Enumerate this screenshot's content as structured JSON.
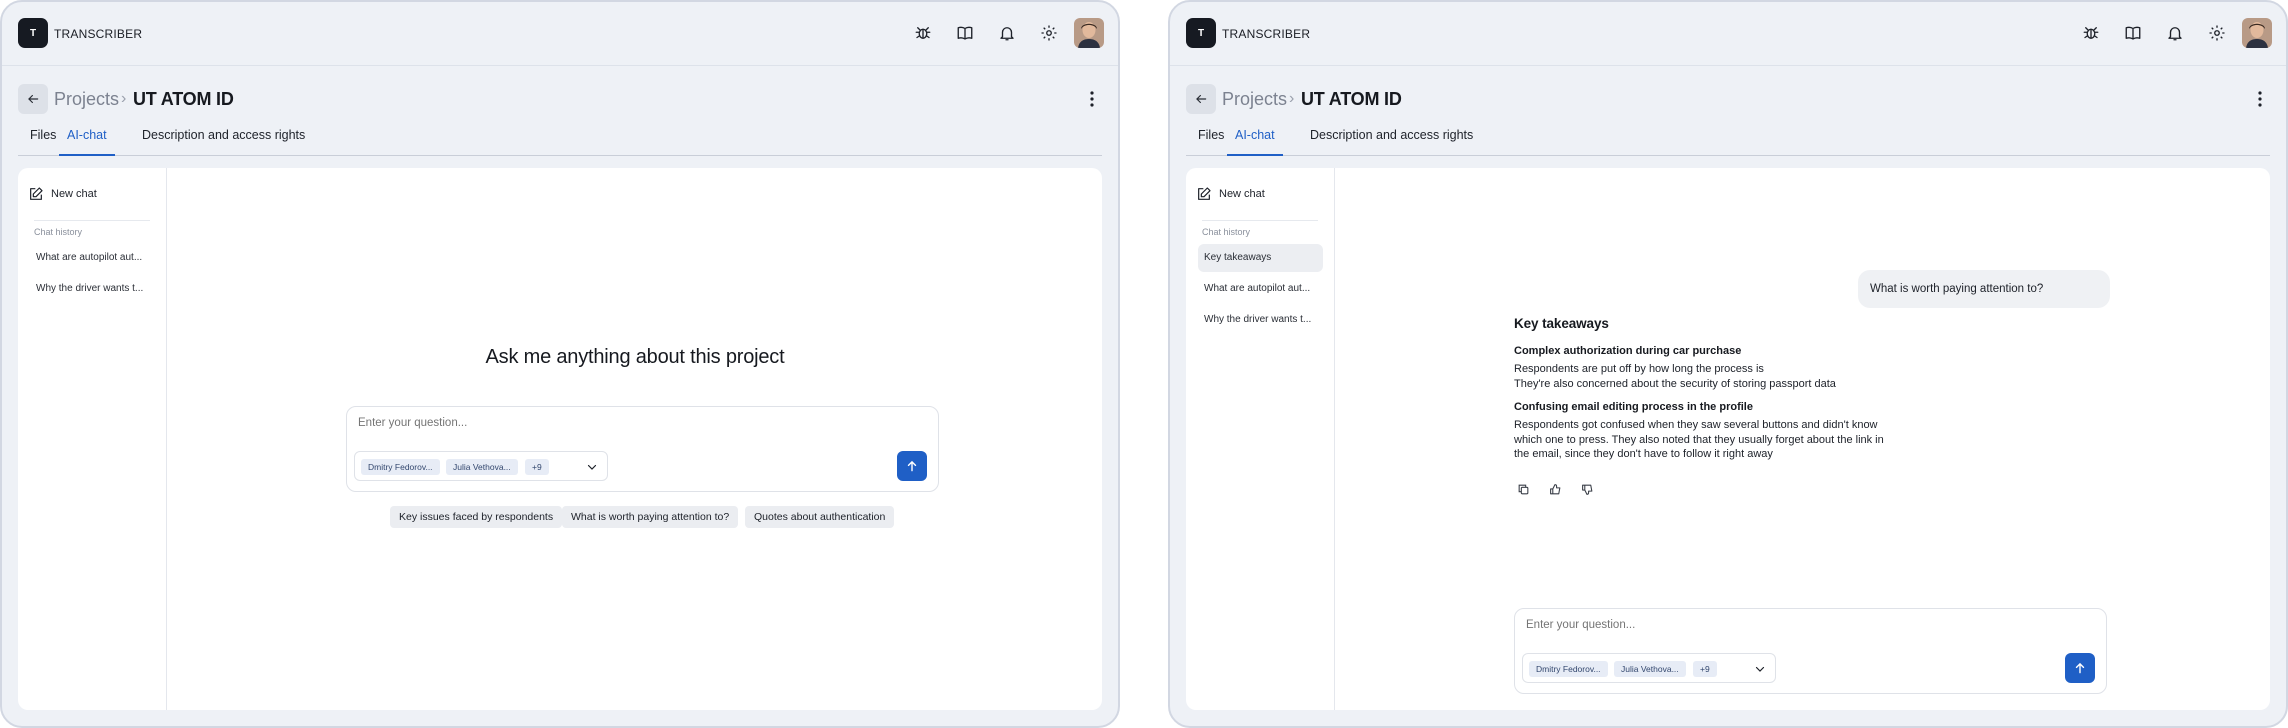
{
  "app": {
    "brand": "TRANSCRIBER",
    "logo_letter": "T"
  },
  "colors": {
    "accent": "#1f5fc6",
    "background": "#eef1f6",
    "panel": "#ffffff"
  },
  "icons": [
    "bug-icon",
    "book-icon",
    "bell-icon",
    "gear-icon",
    "avatar",
    "arrow-left-icon",
    "kebab-icon",
    "edit-icon",
    "chevron-down-icon",
    "arrow-up-icon",
    "copy-icon",
    "thumbs-up-icon",
    "thumbs-down-icon"
  ],
  "screens": [
    {
      "breadcrumb": {
        "parent": "Projects",
        "separator": "›",
        "current": "UT ATOM ID"
      },
      "tabs": [
        {
          "label": "Files",
          "active": false
        },
        {
          "label": "AI-chat",
          "active": true
        },
        {
          "label": "Description and access rights",
          "active": false
        }
      ],
      "sidebar": {
        "new_chat": "New chat",
        "history_label": "Chat history",
        "items": [
          "What are autopilot aut...",
          "Why the driver wants t..."
        ]
      },
      "hero": "Ask me anything about this project",
      "composer": {
        "placeholder": "Enter your question...",
        "chips": [
          "Dmitry Fedorov...",
          "Julia Vethova...",
          "+9"
        ]
      },
      "suggestions": [
        "Key issues faced by respondents",
        "What is worth paying attention to?",
        "Quotes about authentication"
      ]
    },
    {
      "breadcrumb": {
        "parent": "Projects",
        "separator": "›",
        "current": "UT ATOM ID"
      },
      "tabs": [
        {
          "label": "Files",
          "active": false
        },
        {
          "label": "AI-chat",
          "active": true
        },
        {
          "label": "Description and access rights",
          "active": false
        }
      ],
      "sidebar": {
        "new_chat": "New chat",
        "history_label": "Chat history",
        "items": [
          "Key takeaways",
          "What are autopilot aut...",
          "Why the driver wants t..."
        ]
      },
      "user_message": "What is worth paying attention to?",
      "answer": {
        "title": "Key takeaways",
        "sections": [
          {
            "heading": "Complex authorization during car purchase",
            "lines": [
              "Respondents are put off by how long the process is",
              "They're also concerned about the security of storing passport data"
            ]
          },
          {
            "heading": "Confusing email editing process in the profile",
            "lines": [
              "Respondents got confused when they saw several buttons and didn't know",
              "which one to press. They also noted that they usually forget about the link in",
              "the email, since they don't have to follow it right away"
            ]
          }
        ]
      },
      "composer": {
        "placeholder": "Enter your question...",
        "chips": [
          "Dmitry Fedorov...",
          "Julia Vethova...",
          "+9"
        ]
      }
    }
  ]
}
